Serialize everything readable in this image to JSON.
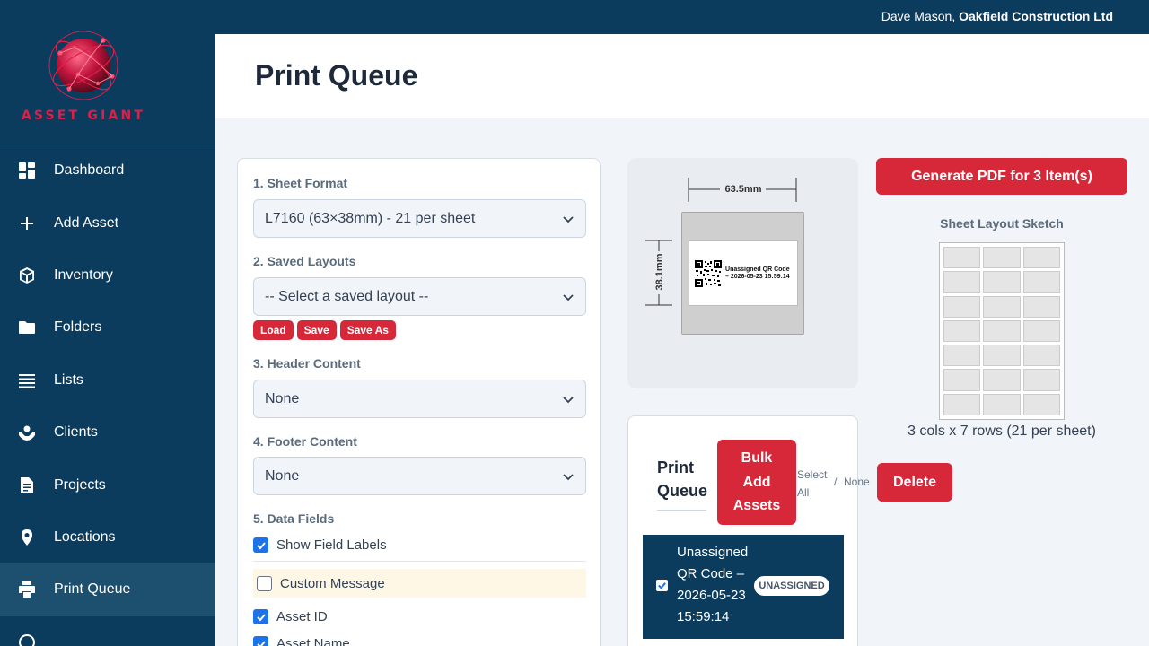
{
  "brand": {
    "name": "ASSET GIANT"
  },
  "topbar": {
    "user_name": "Dave Mason,",
    "company": "Oakfield Construction Ltd"
  },
  "sidebar": {
    "items": [
      {
        "label": "Dashboard",
        "icon": "dashboard-icon"
      },
      {
        "label": "Add Asset",
        "icon": "plus-icon"
      },
      {
        "label": "Inventory",
        "icon": "cube-icon"
      },
      {
        "label": "Folders",
        "icon": "folder-icon"
      },
      {
        "label": "Lists",
        "icon": "list-icon"
      },
      {
        "label": "Clients",
        "icon": "handshake-icon"
      },
      {
        "label": "Projects",
        "icon": "document-icon"
      },
      {
        "label": "Locations",
        "icon": "location-pin-icon"
      },
      {
        "label": "Print Queue",
        "icon": "printer-icon",
        "active": true
      }
    ]
  },
  "page": {
    "title": "Print Queue"
  },
  "settings": {
    "sheet_format": {
      "title": "1. Sheet Format",
      "value": "L7160 (63×38mm) - 21 per sheet"
    },
    "saved_layouts": {
      "title": "2. Saved Layouts",
      "value": "-- Select a saved layout --",
      "load": "Load",
      "save": "Save",
      "save_as": "Save As"
    },
    "header": {
      "title": "3. Header Content",
      "value": "None"
    },
    "footer": {
      "title": "4. Footer Content",
      "value": "None"
    },
    "data_fields": {
      "title": "5. Data Fields",
      "show_labels": {
        "label": "Show Field Labels",
        "checked": true
      },
      "custom_message": {
        "label": "Custom Message",
        "checked": false
      },
      "asset_id": {
        "label": "Asset ID",
        "checked": true
      },
      "asset_name": {
        "label": "Asset Name",
        "checked": true
      }
    }
  },
  "preview": {
    "width_dim": "63.5mm",
    "height_dim": "38.1mm",
    "label_line1": "Unassigned QR Code",
    "label_line2": "– 2026-05-23 15:59:14"
  },
  "queue": {
    "title_line1": "Print",
    "title_line2": "Queue",
    "bulk_line1": "Bulk",
    "bulk_line2": "Add",
    "bulk_line3": "Assets",
    "select_all_1": "Select",
    "select_all_2": "All",
    "separator": "/",
    "select_none": "None",
    "item": {
      "line1": "Unassigned",
      "line2": "QR Code –",
      "line3": "2026-05-23",
      "line4": "15:59:14",
      "badge": "UNASSIGNED",
      "checked": true
    }
  },
  "actions": {
    "delete": "Delete",
    "generate_pdf": "Generate PDF for 3 Item(s)"
  },
  "sketch": {
    "title": "Sheet Layout Sketch",
    "caption": "3 cols x 7 rows (21 per sheet)",
    "cols": 3,
    "rows": 7
  },
  "colors": {
    "navy": "#0b3c5d",
    "accent_red": "#d62839",
    "checkbox_blue": "#1a73e8"
  }
}
